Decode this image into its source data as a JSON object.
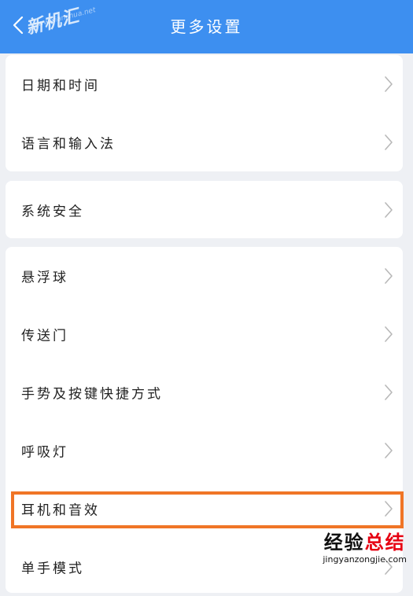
{
  "header": {
    "title": "更多设置",
    "watermark": "新机汇",
    "watermark_url": "www.xianshua.net"
  },
  "cards": [
    {
      "items": [
        {
          "label": "日期和时间"
        },
        {
          "label": "语言和输入法"
        }
      ]
    },
    {
      "items": [
        {
          "label": "系统安全"
        }
      ]
    },
    {
      "items": [
        {
          "label": "悬浮球"
        },
        {
          "label": "传送门"
        },
        {
          "label": "手势及按键快捷方式"
        },
        {
          "label": "呼吸灯"
        },
        {
          "label": "耳机和音效",
          "highlighted": true
        },
        {
          "label": "单手模式"
        }
      ]
    }
  ],
  "corner_watermark": {
    "text_a": "经验",
    "text_b": "总结",
    "url": "jingyanzongjie.com"
  },
  "colors": {
    "header_bg": "#3d8ff0",
    "page_bg": "#eef0f4",
    "highlight": "#f07526"
  }
}
